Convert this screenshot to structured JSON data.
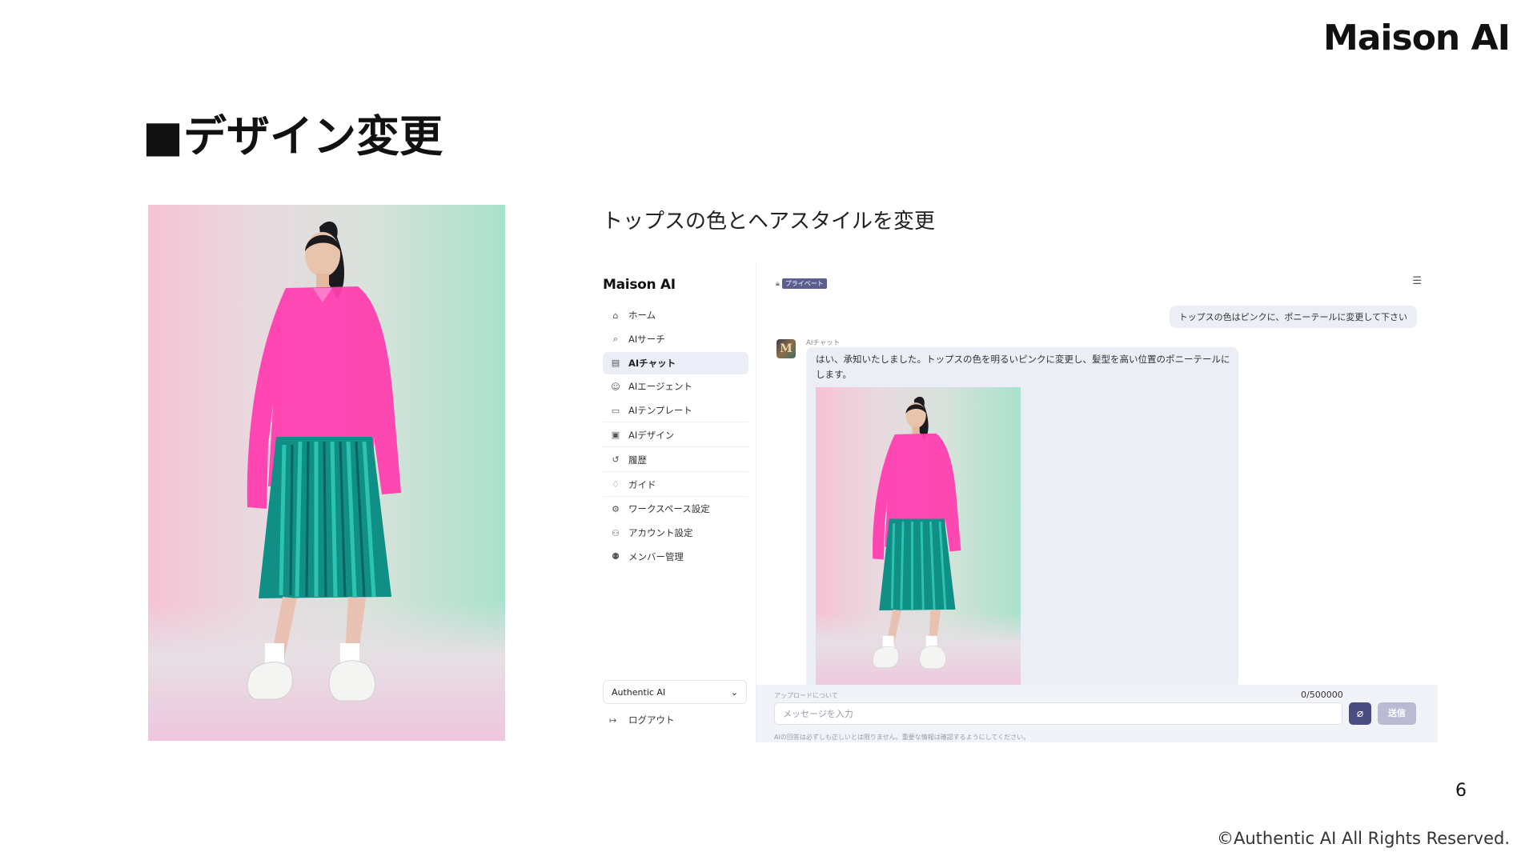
{
  "slide": {
    "brand": "Maison AI",
    "title": "■デザイン変更",
    "subtitle": "トップスの色とヘアスタイルを変更",
    "page_number": "6",
    "copyright": "©Authentic AI All Rights Reserved."
  },
  "app": {
    "logo": "Maison AI",
    "nav": [
      {
        "label": "ホーム",
        "icon": "home-icon",
        "active": false
      },
      {
        "label": "AIサーチ",
        "icon": "search-icon",
        "active": false
      },
      {
        "label": "AIチャット",
        "icon": "chat-icon",
        "active": true
      },
      {
        "label": "AIエージェント",
        "icon": "agent-icon",
        "active": false
      },
      {
        "label": "AIテンプレート",
        "icon": "folder-icon",
        "active": false
      },
      {
        "label": "AIデザイン",
        "icon": "image-icon",
        "active": false
      },
      {
        "label": "履歴",
        "icon": "history-icon",
        "active": false
      },
      {
        "label": "ガイド",
        "icon": "guide-icon",
        "active": false
      },
      {
        "label": "ワークスペース設定",
        "icon": "gear-icon",
        "active": false
      },
      {
        "label": "アカウント設定",
        "icon": "user-settings-icon",
        "active": false
      },
      {
        "label": "メンバー管理",
        "icon": "members-icon",
        "active": false
      }
    ],
    "workspace_selected": "Authentic AI",
    "logout_label": "ログアウト",
    "private_badge": "プライベート",
    "user_message": "トップスの色はピンクに、ポニーテールに変更して下さい",
    "ai_name": "AIチャット",
    "ai_reply": "はい、承知いたしました。トップスの色を明るいピンクに変更し、髪型を高い位置のポニーテールにします。",
    "upload_note": "アップロードについて",
    "char_count": "0/500000",
    "input_placeholder": "メッセージを入力",
    "send_label": "送信",
    "disclaimer": "AIの回答は必ずしも正しいとは限りません。重要な情報は確認するようにしてください。"
  },
  "colors": {
    "accent": "#4a4d82",
    "active_nav_bg": "#eceef7",
    "badge_bg": "#5b5f8f",
    "top_pink": "#ff3fb0",
    "skirt_teal": "#0f8f86"
  }
}
